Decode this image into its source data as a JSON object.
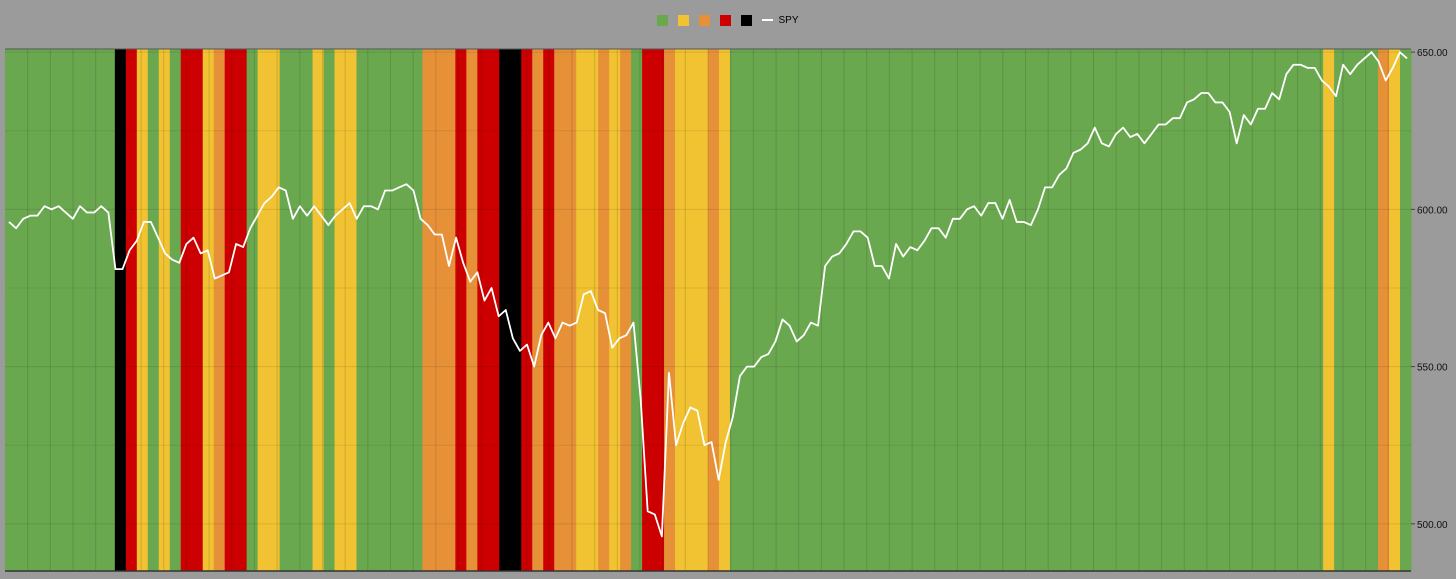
{
  "legend": {
    "items": [
      {
        "color": "#6aa84f",
        "label": ""
      },
      {
        "color": "#f1c232",
        "label": ""
      },
      {
        "color": "#e69138",
        "label": ""
      },
      {
        "color": "#cc0000",
        "label": ""
      },
      {
        "color": "#000000",
        "label": ""
      }
    ],
    "line_label": "SPY"
  },
  "chart_data": {
    "type": "line",
    "title": "",
    "xlabel": "",
    "ylabel": "",
    "ylim": [
      485,
      651
    ],
    "yticks": [
      500,
      550,
      600,
      650
    ],
    "ytick_labels": [
      "500.00",
      "550.00",
      "600.00",
      "650.00"
    ],
    "regime_colors": {
      "G": "#6aa84f",
      "Y": "#f1c232",
      "O": "#e69138",
      "R": "#cc0000",
      "K": "#000000"
    },
    "regimes": [
      "G",
      "G",
      "G",
      "G",
      "G",
      "G",
      "G",
      "G",
      "G",
      "G",
      "K",
      "R",
      "Y",
      "G",
      "Y",
      "G",
      "R",
      "R",
      "Y",
      "O",
      "R",
      "R",
      "G",
      "Y",
      "Y",
      "G",
      "G",
      "G",
      "Y",
      "G",
      "Y",
      "Y",
      "G",
      "G",
      "G",
      "G",
      "G",
      "G",
      "O",
      "O",
      "O",
      "R",
      "O",
      "R",
      "R",
      "K",
      "K",
      "R",
      "O",
      "R",
      "O",
      "O",
      "Y",
      "Y",
      "O",
      "Y",
      "O",
      "G",
      "R",
      "R",
      "O",
      "Y",
      "Y",
      "Y",
      "O",
      "Y",
      "G",
      "G",
      "G",
      "G",
      "G",
      "G",
      "G",
      "G",
      "G",
      "G",
      "G",
      "G",
      "G",
      "G",
      "G",
      "G",
      "G",
      "G",
      "G",
      "G",
      "G",
      "G",
      "G",
      "G",
      "G",
      "G",
      "G",
      "G",
      "G",
      "G",
      "G",
      "G",
      "G",
      "G",
      "G",
      "G",
      "G",
      "G",
      "G",
      "G",
      "G",
      "G",
      "G",
      "G",
      "G",
      "G",
      "G",
      "G",
      "G",
      "G",
      "G",
      "G",
      "G",
      "G",
      "Y",
      "G",
      "G",
      "G",
      "G",
      "O",
      "Y",
      "G"
    ],
    "series": [
      {
        "name": "SPY",
        "color": "#ffffff",
        "values": [
          596,
          594,
          597,
          598,
          598,
          601,
          600,
          601,
          599,
          597,
          601,
          599,
          599,
          601,
          599,
          581,
          581,
          587,
          590,
          596,
          596,
          591,
          586,
          584,
          583,
          589,
          591,
          586,
          587,
          578,
          579,
          580,
          589,
          588,
          594,
          598,
          602,
          604,
          607,
          606,
          597,
          601,
          598,
          601,
          598,
          595,
          598,
          600,
          602,
          597,
          601,
          601,
          600,
          606,
          606,
          607,
          608,
          606,
          597,
          595,
          592,
          592,
          582,
          591,
          583,
          577,
          580,
          571,
          575,
          566,
          568,
          559,
          555,
          557,
          550,
          560,
          564,
          559,
          564,
          563,
          564,
          573,
          574,
          568,
          567,
          556,
          559,
          560,
          564,
          540,
          504,
          503,
          496,
          548,
          525,
          532,
          537,
          536,
          525,
          526,
          514,
          526,
          534,
          547,
          550,
          550,
          553,
          554,
          558,
          565,
          563,
          558,
          560,
          564,
          563,
          582,
          585,
          586,
          589,
          593,
          593,
          591,
          582,
          582,
          578,
          589,
          585,
          588,
          587,
          590,
          594,
          594,
          591,
          597,
          597,
          600,
          601,
          598,
          602,
          602,
          597,
          603,
          596,
          596,
          595,
          600,
          607,
          607,
          611,
          613,
          618,
          619,
          621,
          626,
          621,
          620,
          624,
          626,
          623,
          624,
          621,
          624,
          627,
          627,
          629,
          629,
          634,
          635,
          637,
          637,
          634,
          634,
          631,
          621,
          630,
          627,
          632,
          632,
          637,
          635,
          643,
          646,
          646,
          645,
          645,
          641,
          639,
          636,
          646,
          643,
          646,
          648,
          650,
          647,
          641,
          645,
          650,
          648
        ]
      }
    ]
  }
}
